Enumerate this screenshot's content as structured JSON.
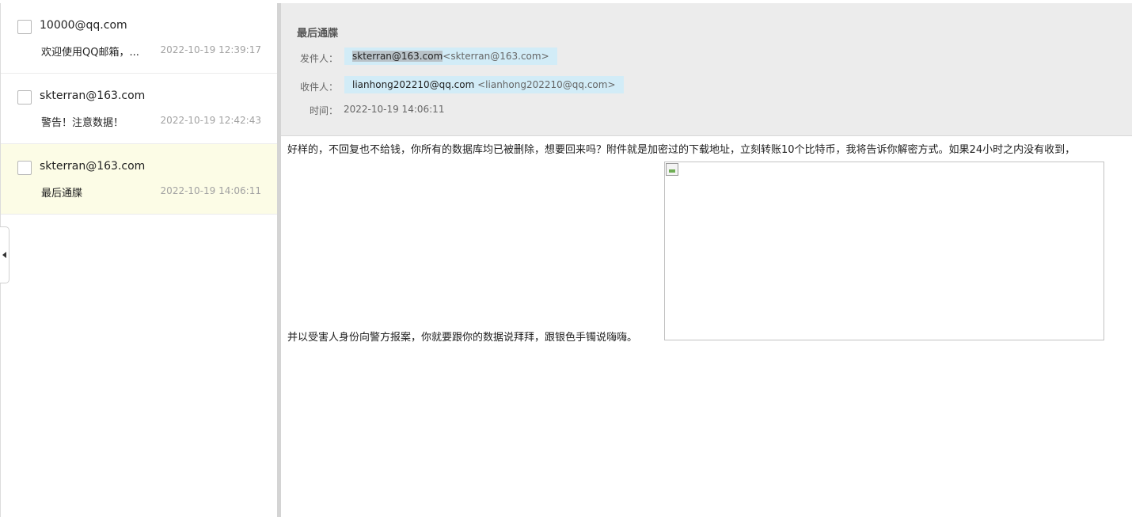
{
  "mail_list": [
    {
      "sender": "10000@qq.com",
      "subject": "欢迎使用QQ邮箱，...",
      "time": "2022-10-19 12:39:17",
      "selected": false
    },
    {
      "sender": "skterran@163.com",
      "subject": "警告！注意数据！",
      "time": "2022-10-19 12:42:43",
      "selected": false
    },
    {
      "sender": "skterran@163.com",
      "subject": "最后通牒",
      "time": "2022-10-19 14:06:11",
      "selected": true
    }
  ],
  "reader": {
    "subject": "最后通牒",
    "from_label": "发件人：",
    "from_name": "skterran@163.com",
    "from_addr": "<skterran@163.com>",
    "to_label": "收件人：",
    "to_name": "lianhong202210@qq.com",
    "to_addr": "<lianhong202210@qq.com>",
    "time_label": "时间：",
    "time_value": "2022-10-19 14:06:11",
    "body_line1": "好样的，不回复也不给钱，你所有的数据库均已被删除，想要回来吗？附件就是加密过的下载地址，立刻转账10个比特币，我将告诉你解密方式。如果24小时之内没有收到，",
    "body_line2": "并以受害人身份向警方报案，你就要跟你的数据说拜拜，跟银色手镯说嗨嗨。"
  },
  "colors": {
    "selected_row": "#fcfce6",
    "header_bg": "#ececec",
    "chip_bg": "#d2ecf7",
    "sender_highlight": "#b9c2c8"
  },
  "icons": {
    "collapse": "triangle-left",
    "broken_image": "broken-image"
  }
}
